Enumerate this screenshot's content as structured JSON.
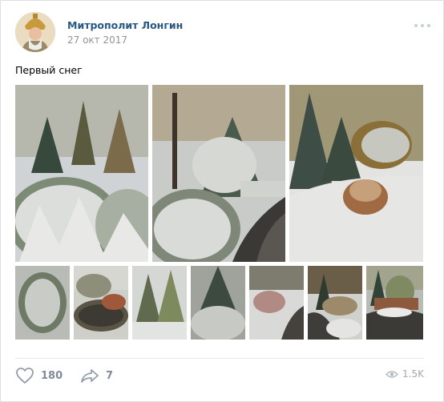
{
  "post": {
    "author": "Митрополит Лонгин",
    "date": "27 окт 2017",
    "text": "Первый снег"
  },
  "actions": {
    "likes": "180",
    "shares": "7",
    "views": "1.5K"
  },
  "icons": {
    "like": "heart-outline-icon",
    "share": "share-arrow-icon",
    "views": "eye-icon",
    "more": "more-dots-icon"
  },
  "colors": {
    "link": "#2a5885",
    "muted": "#828a99",
    "background": "#edeef0"
  }
}
